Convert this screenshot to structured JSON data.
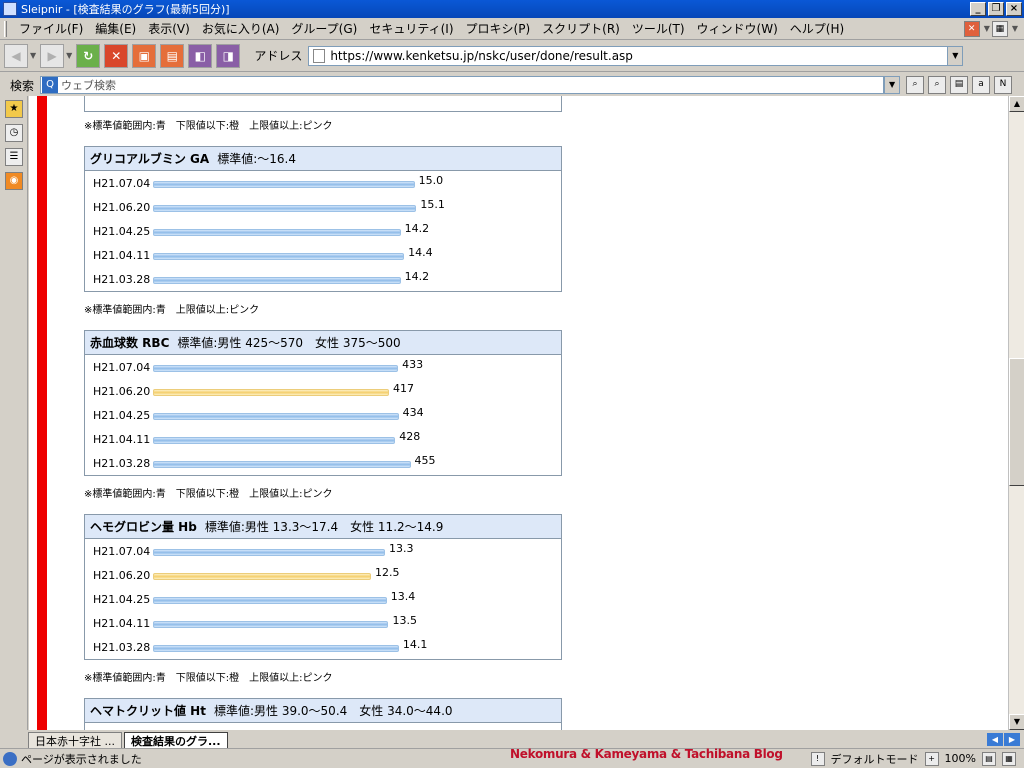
{
  "window": {
    "title": "Sleipnir - [検査結果のグラフ(最新5回分)]",
    "buttons": [
      "_",
      "❐",
      "×"
    ]
  },
  "menu": [
    "ファイル(F)",
    "編集(E)",
    "表示(V)",
    "お気に入り(A)",
    "グループ(G)",
    "セキュリティ(I)",
    "プロキシ(P)",
    "スクリプト(R)",
    "ツール(T)",
    "ウィンドウ(W)",
    "ヘルプ(H)"
  ],
  "toolbar": {
    "address_label": "アドレス",
    "address_value": "https://www.kenketsu.jp/nskc/user/done/result.asp"
  },
  "search": {
    "label": "検索",
    "placeholder": "ウェブ検索"
  },
  "sections": [
    {
      "title": "グリコアルブミン GA",
      "reference": "標準値:～16.4",
      "rows": [
        {
          "date": "H21.07.04",
          "value": "15.0",
          "status": "normal"
        },
        {
          "date": "H21.06.20",
          "value": "15.1",
          "status": "normal"
        },
        {
          "date": "H21.04.25",
          "value": "14.2",
          "status": "normal"
        },
        {
          "date": "H21.04.11",
          "value": "14.4",
          "status": "normal"
        },
        {
          "date": "H21.03.28",
          "value": "14.2",
          "status": "normal"
        }
      ],
      "note": "※標準値範囲内:青　上限値以上:ピンク"
    },
    {
      "title": "赤血球数 RBC",
      "reference": "標準値:男性 425～570　女性 375～500",
      "rows": [
        {
          "date": "H21.07.04",
          "value": "433",
          "status": "normal"
        },
        {
          "date": "H21.06.20",
          "value": "417",
          "status": "low"
        },
        {
          "date": "H21.04.25",
          "value": "434",
          "status": "normal"
        },
        {
          "date": "H21.04.11",
          "value": "428",
          "status": "normal"
        },
        {
          "date": "H21.03.28",
          "value": "455",
          "status": "normal"
        }
      ],
      "note": "※標準値範囲内:青　下限値以下:橙　上限値以上:ピンク"
    },
    {
      "title": "ヘモグロビン量 Hb",
      "reference": "標準値:男性 13.3～17.4　女性 11.2～14.9",
      "rows": [
        {
          "date": "H21.07.04",
          "value": "13.3",
          "status": "normal"
        },
        {
          "date": "H21.06.20",
          "value": "12.5",
          "status": "low"
        },
        {
          "date": "H21.04.25",
          "value": "13.4",
          "status": "normal"
        },
        {
          "date": "H21.04.11",
          "value": "13.5",
          "status": "normal"
        },
        {
          "date": "H21.03.28",
          "value": "14.1",
          "status": "normal"
        }
      ],
      "note": "※標準値範囲内:青　下限値以下:橙　上限値以上:ピンク"
    },
    {
      "title": "ヘマトクリット値 Ht",
      "reference": "標準値:男性 39.0～50.4　女性 34.0～44.0",
      "rows": [],
      "note": ""
    }
  ],
  "top_partial": {
    "note": "※標準値範囲内:青　下限値以下:橙　上限値以上:ピンク"
  },
  "tabs": [
    {
      "label": "日本赤十字社 ...",
      "active": false
    },
    {
      "label": "検査結果のグラ...",
      "active": true
    }
  ],
  "status": {
    "text": "ページが表示されました",
    "mode": "デフォルトモード",
    "zoom": "100%",
    "watermark": "Nekomura & Kameyama & Tachibana Blog"
  },
  "colors": {
    "normal_bar": "#8fbbe8",
    "low_bar": "#f4cf6c",
    "header_bg": "#dde8f8",
    "red_bar": "#ee0000"
  }
}
